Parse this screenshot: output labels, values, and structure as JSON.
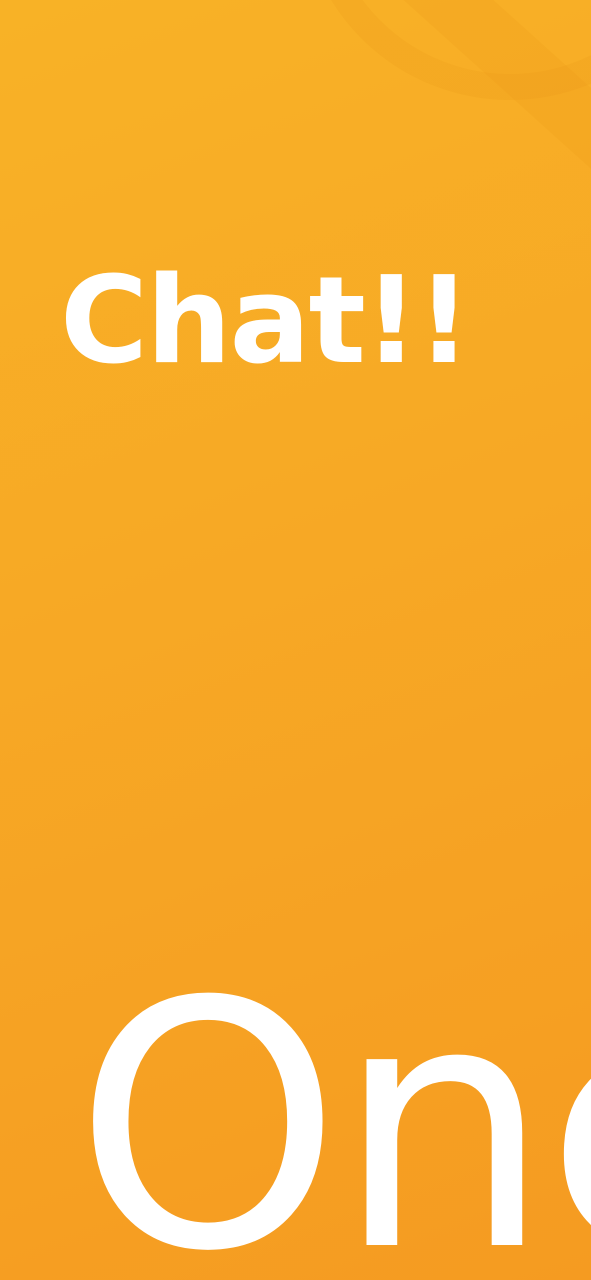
{
  "screen": {
    "heading": "Chat!!",
    "brand_text": "One",
    "colors": {
      "background_start": "#f8b226",
      "background_end": "#f59b21",
      "text": "#ffffff"
    }
  }
}
